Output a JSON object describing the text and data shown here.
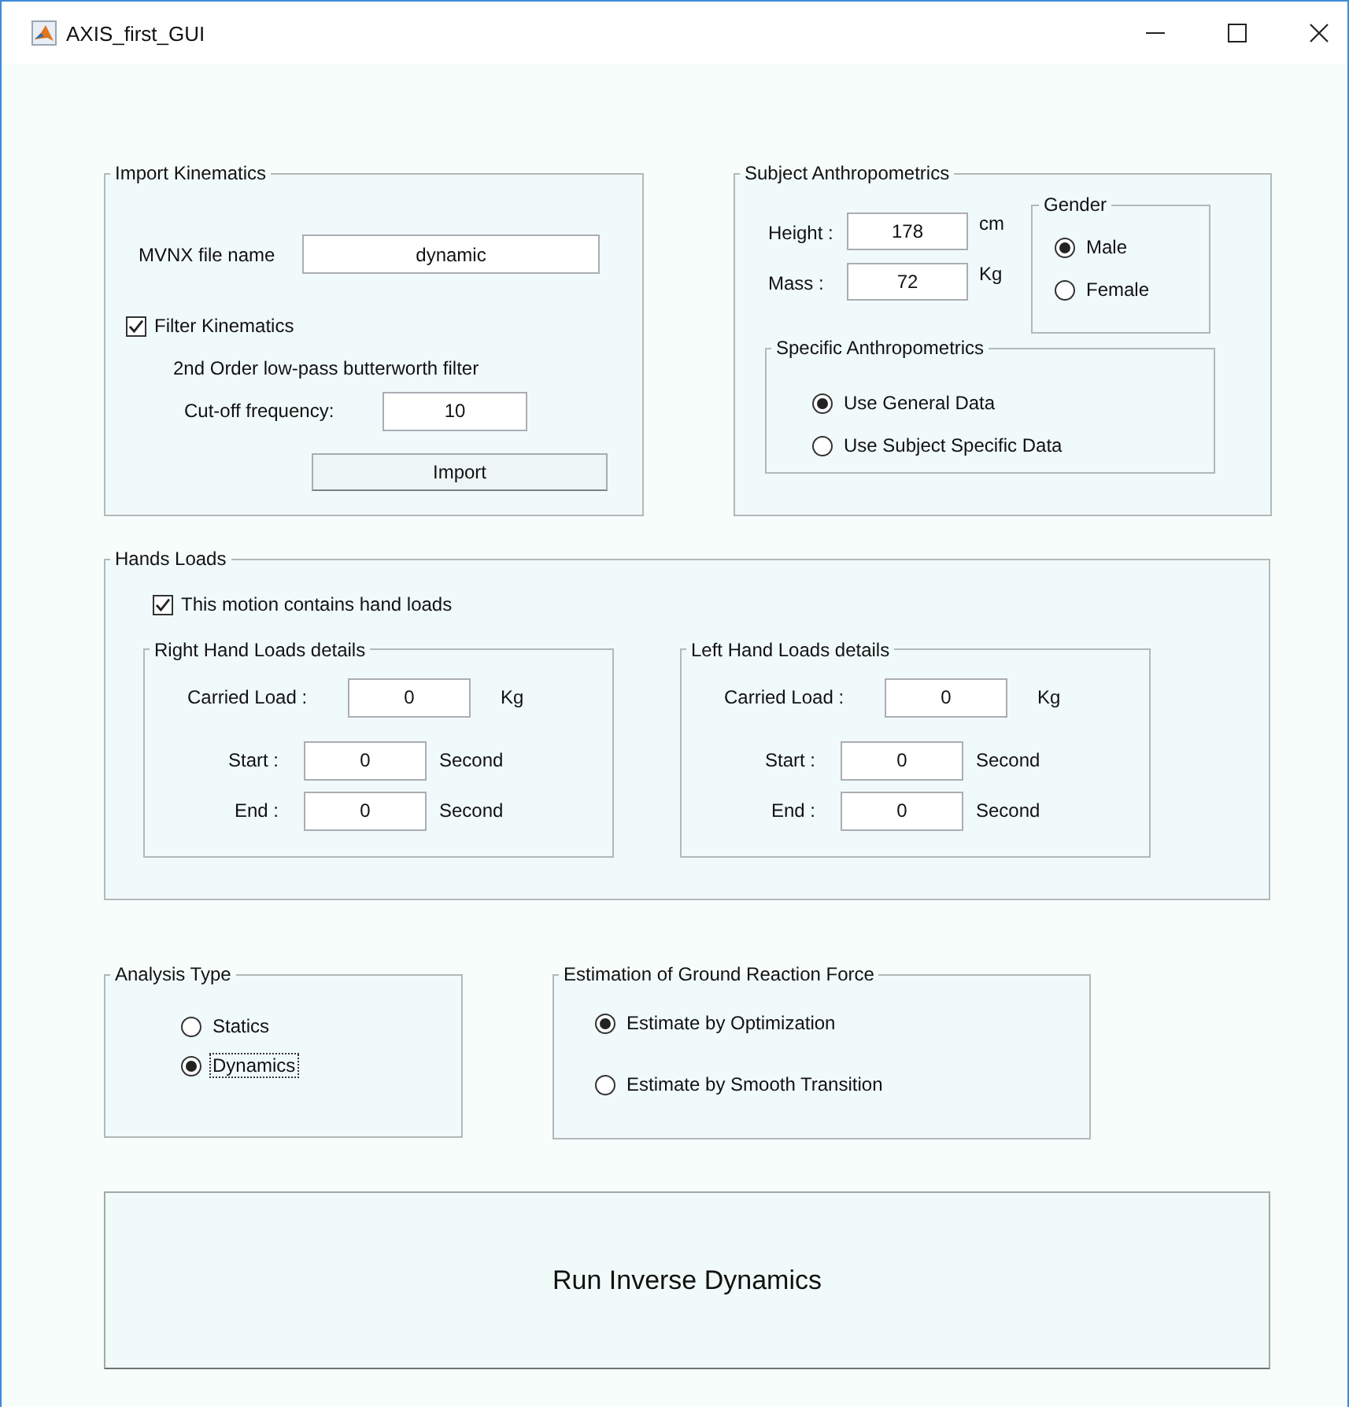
{
  "window": {
    "title": "AXIS_first_GUI"
  },
  "import_kinematics": {
    "title": "Import Kinematics",
    "file_label": "MVNX file name",
    "file_value": "dynamic",
    "filter": {
      "label": "Filter Kinematics",
      "checked": true
    },
    "filter_note": "2nd Order low-pass butterworth filter",
    "cutoff_label": "Cut-off frequency:",
    "cutoff_value": "10",
    "import_button": "Import"
  },
  "subject": {
    "title": "Subject Anthropometrics",
    "fields": [
      {
        "label": "Height :",
        "value": "178",
        "unit": "cm"
      },
      {
        "label": "Mass :",
        "value": "72",
        "unit": "Kg"
      }
    ],
    "gender": {
      "title": "Gender",
      "options": [
        {
          "label": "Male",
          "selected": true
        },
        {
          "label": "Female",
          "selected": false
        }
      ]
    },
    "specific": {
      "title": "Specific Anthropometrics",
      "options": [
        {
          "label": "Use General Data",
          "selected": true
        },
        {
          "label": "Use Subject Specific Data",
          "selected": false
        }
      ]
    }
  },
  "hands_loads": {
    "title": "Hands Loads",
    "checkbox": {
      "label": "This motion contains hand loads",
      "checked": true
    },
    "panels": [
      {
        "title": "Right Hand Loads details",
        "load_label": "Carried Load :",
        "load_value": "0",
        "load_unit": "Kg",
        "start_label": "Start :",
        "start_value": "0",
        "start_unit": "Second",
        "end_label": "End :",
        "end_value": "0",
        "end_unit": "Second"
      },
      {
        "title": "Left Hand Loads details",
        "load_label": "Carried Load :",
        "load_value": "0",
        "load_unit": "Kg",
        "start_label": "Start :",
        "start_value": "0",
        "start_unit": "Second",
        "end_label": "End :",
        "end_value": "0",
        "end_unit": "Second"
      }
    ]
  },
  "analysis_type": {
    "title": "Analysis Type",
    "options": [
      {
        "label": "Statics",
        "selected": false,
        "focused": false
      },
      {
        "label": "Dynamics",
        "selected": true,
        "focused": true
      }
    ]
  },
  "grf": {
    "title": "Estimation of Ground Reaction Force",
    "options": [
      {
        "label": "Estimate by Optimization",
        "selected": true
      },
      {
        "label": "Estimate by Smooth Transition",
        "selected": false
      }
    ]
  },
  "run_button": "Run Inverse Dynamics"
}
